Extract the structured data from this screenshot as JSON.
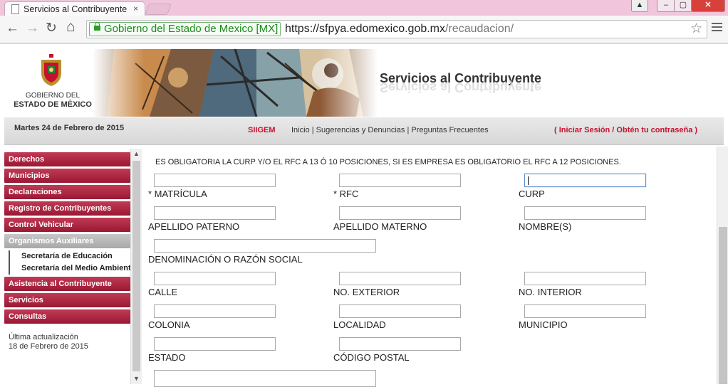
{
  "browser": {
    "tab_title": "Servicios al Contribuyente",
    "tab_close": "×",
    "window_buttons": {
      "minimize": "–",
      "maximize": "▢",
      "close": "✕"
    },
    "ev_label": "Gobierno del Estado de Mexico [MX]",
    "url_scheme": "https://",
    "url_host": "sfpya.edomexico.gob.mx",
    "url_path": "/recaudacion/"
  },
  "header": {
    "logo_line1": "GOBIERNO DEL",
    "logo_line2": "ESTADO DE MÉXICO",
    "site_title": "Servicios al Contribuyente"
  },
  "infobar": {
    "date": "Martes 24 de Febrero de 2015",
    "siigem": "SIIGEM",
    "links": "Inicio | Sugerencias y Denuncias | Preguntas Frecuentes",
    "login": "( Iniciar Sesión  / Obtén tu contraseña )"
  },
  "sidebar": {
    "items": [
      {
        "label": "Derechos"
      },
      {
        "label": "Municipios"
      },
      {
        "label": "Declaraciones"
      },
      {
        "label": "Registro de Contribuyentes"
      },
      {
        "label": "Control Vehicular"
      },
      {
        "label": "Organismos Auxiliares"
      }
    ],
    "subitems": [
      {
        "label": "Secretaría de Educación"
      },
      {
        "label": "Secretaría del Medio Ambiente"
      }
    ],
    "items_after": [
      {
        "label": "Asistencia al Contribuyente"
      },
      {
        "label": "Servicios"
      },
      {
        "label": "Consultas"
      }
    ],
    "update_label": "Última actualización",
    "update_date": "18 de Febrero de 2015"
  },
  "form": {
    "notice": "ES OBLIGATORIA LA CURP Y/O EL RFC A 13 Ó 10 POSICIONES, SI ES EMPRESA ES OBLIGATORIO EL RFC A 12 POSICIONES.",
    "labels": {
      "matricula": "*  MATRÍCULA",
      "rfc": "*  RFC",
      "curp": "CURP",
      "apellido_paterno": "APELLIDO PATERNO",
      "apellido_materno": "APELLIDO MATERNO",
      "nombres": "NOMBRE(S)",
      "razon_social": "DENOMINACIÓN O RAZÓN SOCIAL",
      "calle": "CALLE",
      "no_exterior": "NO. EXTERIOR",
      "no_interior": "NO. INTERIOR",
      "colonia": "COLONIA",
      "localidad": "LOCALIDAD",
      "municipio": "MUNICIPIO",
      "estado": "ESTADO",
      "codigo_postal": "CÓDIGO POSTAL"
    },
    "values": {
      "matricula": "",
      "rfc": "",
      "curp": "",
      "apellido_paterno": "",
      "apellido_materno": "",
      "nombres": "",
      "razon_social": "",
      "calle": "",
      "no_exterior": "",
      "no_interior": "",
      "colonia": "",
      "localidad": "",
      "municipio": "",
      "estado": "",
      "codigo_postal": ""
    }
  }
}
